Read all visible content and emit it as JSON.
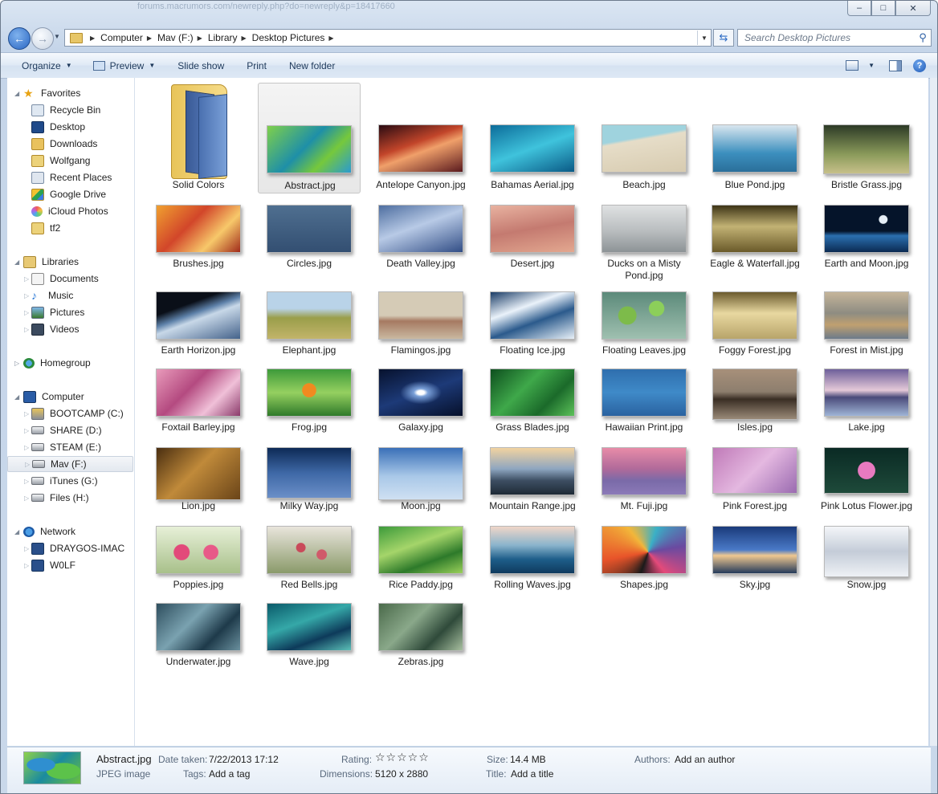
{
  "window": {
    "ghost_title": "forums.macrumors.com/newreply.php?do=newreply&p=18417660",
    "minimize": "‒",
    "maximize": "□",
    "close": "✕"
  },
  "address_bar": {
    "breadcrumbs": [
      "Computer",
      "Mav (F:)",
      "Library",
      "Desktop Pictures"
    ]
  },
  "search": {
    "placeholder": "Search Desktop Pictures"
  },
  "command_bar": {
    "organize": "Organize",
    "preview": "Preview",
    "slide_show": "Slide show",
    "print": "Print",
    "new_folder": "New folder"
  },
  "nav": {
    "favorites": {
      "label": "Favorites",
      "items": [
        "Recycle Bin",
        "Desktop",
        "Downloads",
        "Wolfgang",
        "Recent Places",
        "Google Drive",
        "iCloud Photos",
        "tf2"
      ]
    },
    "libraries": {
      "label": "Libraries",
      "items": [
        "Documents",
        "Music",
        "Pictures",
        "Videos"
      ]
    },
    "homegroup": {
      "label": "Homegroup"
    },
    "computer": {
      "label": "Computer",
      "items": [
        "BOOTCAMP (C:)",
        "SHARE (D:)",
        "STEAM (E:)",
        "Mav (F:)",
        "iTunes (G:)",
        "Files (H:)"
      ]
    },
    "network": {
      "label": "Network",
      "items": [
        "DRAYGOS-IMAC",
        "W0LF"
      ]
    }
  },
  "files": [
    "Solid Colors",
    "Abstract.jpg",
    "Antelope Canyon.jpg",
    "Bahamas Aerial.jpg",
    "Beach.jpg",
    "Blue Pond.jpg",
    "Bristle Grass.jpg",
    "Brushes.jpg",
    "Circles.jpg",
    "Death Valley.jpg",
    "Desert.jpg",
    "Ducks on a Misty Pond.jpg",
    "Eagle & Waterfall.jpg",
    "Earth and Moon.jpg",
    "Earth Horizon.jpg",
    "Elephant.jpg",
    "Flamingos.jpg",
    "Floating Ice.jpg",
    "Floating Leaves.jpg",
    "Foggy Forest.jpg",
    "Forest in Mist.jpg",
    "Foxtail Barley.jpg",
    "Frog.jpg",
    "Galaxy.jpg",
    "Grass Blades.jpg",
    "Hawaiian Print.jpg",
    "Isles.jpg",
    "Lake.jpg",
    "Lion.jpg",
    "Milky Way.jpg",
    "Moon.jpg",
    "Mountain Range.jpg",
    "Mt. Fuji.jpg",
    "Pink Forest.jpg",
    "Pink Lotus Flower.jpg",
    "Poppies.jpg",
    "Red Bells.jpg",
    "Rice Paddy.jpg",
    "Rolling Waves.jpg",
    "Shapes.jpg",
    "Sky.jpg",
    "Snow.jpg",
    "Underwater.jpg",
    "Wave.jpg",
    "Zebras.jpg"
  ],
  "details": {
    "name": "Abstract.jpg",
    "type": "JPEG image",
    "date_taken_label": "Date taken:",
    "date_taken": "7/22/2013 17:12",
    "tags_label": "Tags:",
    "tags": "Add a tag",
    "rating_label": "Rating:",
    "rating_stars": "☆☆☆☆☆",
    "dimensions_label": "Dimensions:",
    "dimensions": "5120 x 2880",
    "size_label": "Size:",
    "size": "14.4 MB",
    "title_label": "Title:",
    "title": "Add a title",
    "authors_label": "Authors:",
    "authors": "Add an author"
  }
}
